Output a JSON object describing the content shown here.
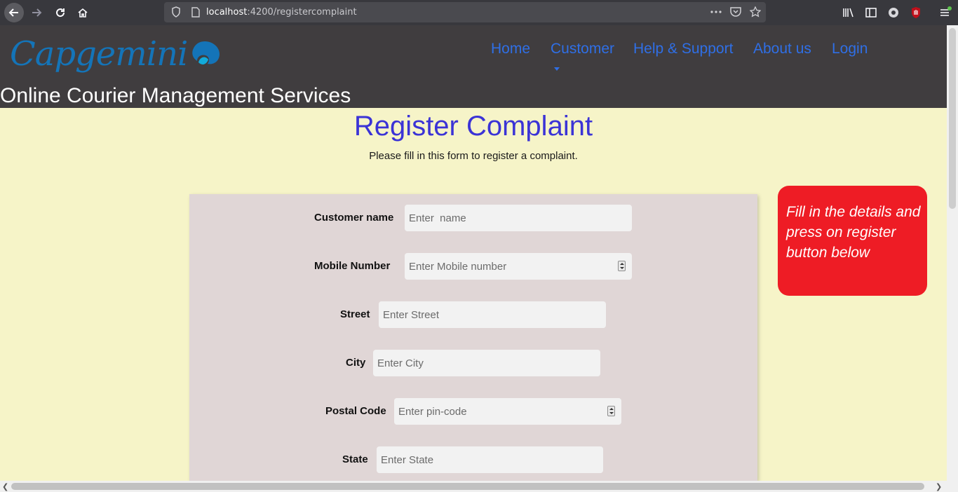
{
  "browser": {
    "url_host": "localhost",
    "url_path": ":4200/registercomplaint"
  },
  "header": {
    "logo_text": "Capgemini",
    "nav": {
      "home": "Home",
      "customer": "Customer",
      "help": "Help & Support",
      "about": "About us",
      "login": "Login"
    },
    "subtitle": "Online Courier Management Services"
  },
  "main": {
    "title": "Register Complaint",
    "subtitle": "Please fill in this form to register a complaint.",
    "form": {
      "customer_name": {
        "label": "Customer name",
        "placeholder": "Enter  name"
      },
      "mobile": {
        "label": "Mobile Number",
        "placeholder": "Enter Mobile number"
      },
      "street": {
        "label": "Street",
        "placeholder": "Enter Street"
      },
      "city": {
        "label": "City",
        "placeholder": "Enter City"
      },
      "postal": {
        "label": "Postal Code",
        "placeholder": "Enter pin-code"
      },
      "state": {
        "label": "State",
        "placeholder": "Enter State"
      }
    },
    "hint": "Fill in the details and press on register button below"
  },
  "colors": {
    "header_bg": "#403d3f",
    "page_bg": "#f6f4c8",
    "nav_link": "#2f6fe6",
    "title": "#3b33d6",
    "form_bg": "#e0d6d6",
    "hint_bg": "#ee1c25",
    "logo": "#1474b8"
  }
}
